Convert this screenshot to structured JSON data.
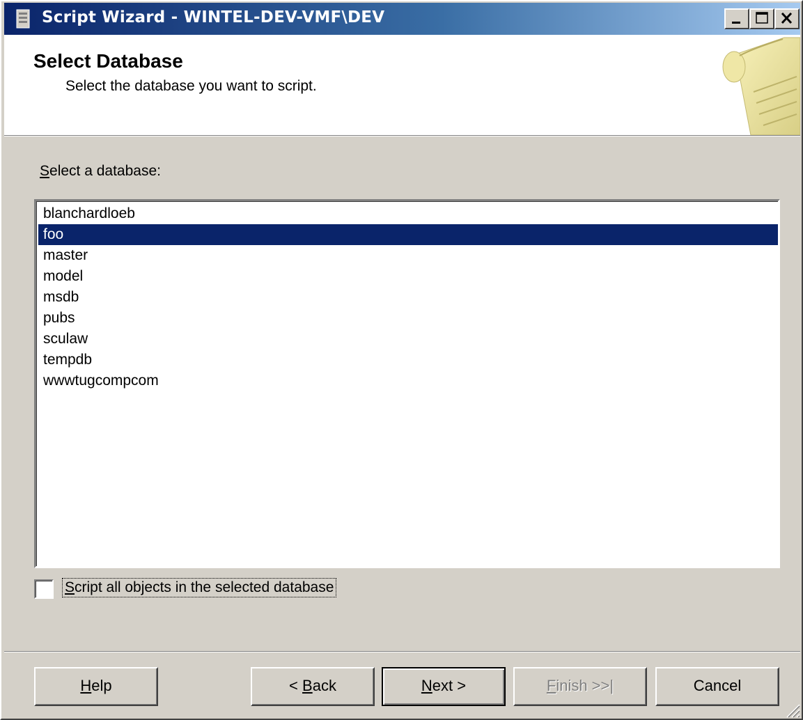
{
  "window": {
    "title": "Script Wizard - WINTEL-DEV-VMF\\DEV"
  },
  "header": {
    "title": "Select Database",
    "subtitle": "Select the database you want to script."
  },
  "database_list": {
    "label_prefix": "S",
    "label_rest": "elect a database:",
    "items": [
      "blanchardloeb",
      "foo",
      "master",
      "model",
      "msdb",
      "pubs",
      "sculaw",
      "tempdb",
      "wwwtugcompcom"
    ],
    "selected": "foo"
  },
  "script_all": {
    "label_prefix": "S",
    "label_rest": "cript all objects in the selected database",
    "checked": false
  },
  "buttons": {
    "help_prefix": "H",
    "help_rest": "elp",
    "back_pre": "< ",
    "back_key": "B",
    "back_rest": "ack",
    "next_key": "N",
    "next_rest": "ext >",
    "finish_key": "F",
    "finish_rest": "inish >>|",
    "cancel": "Cancel"
  },
  "colors": {
    "selection": "#0a246a",
    "dialog_face": "#d4d0c8"
  }
}
